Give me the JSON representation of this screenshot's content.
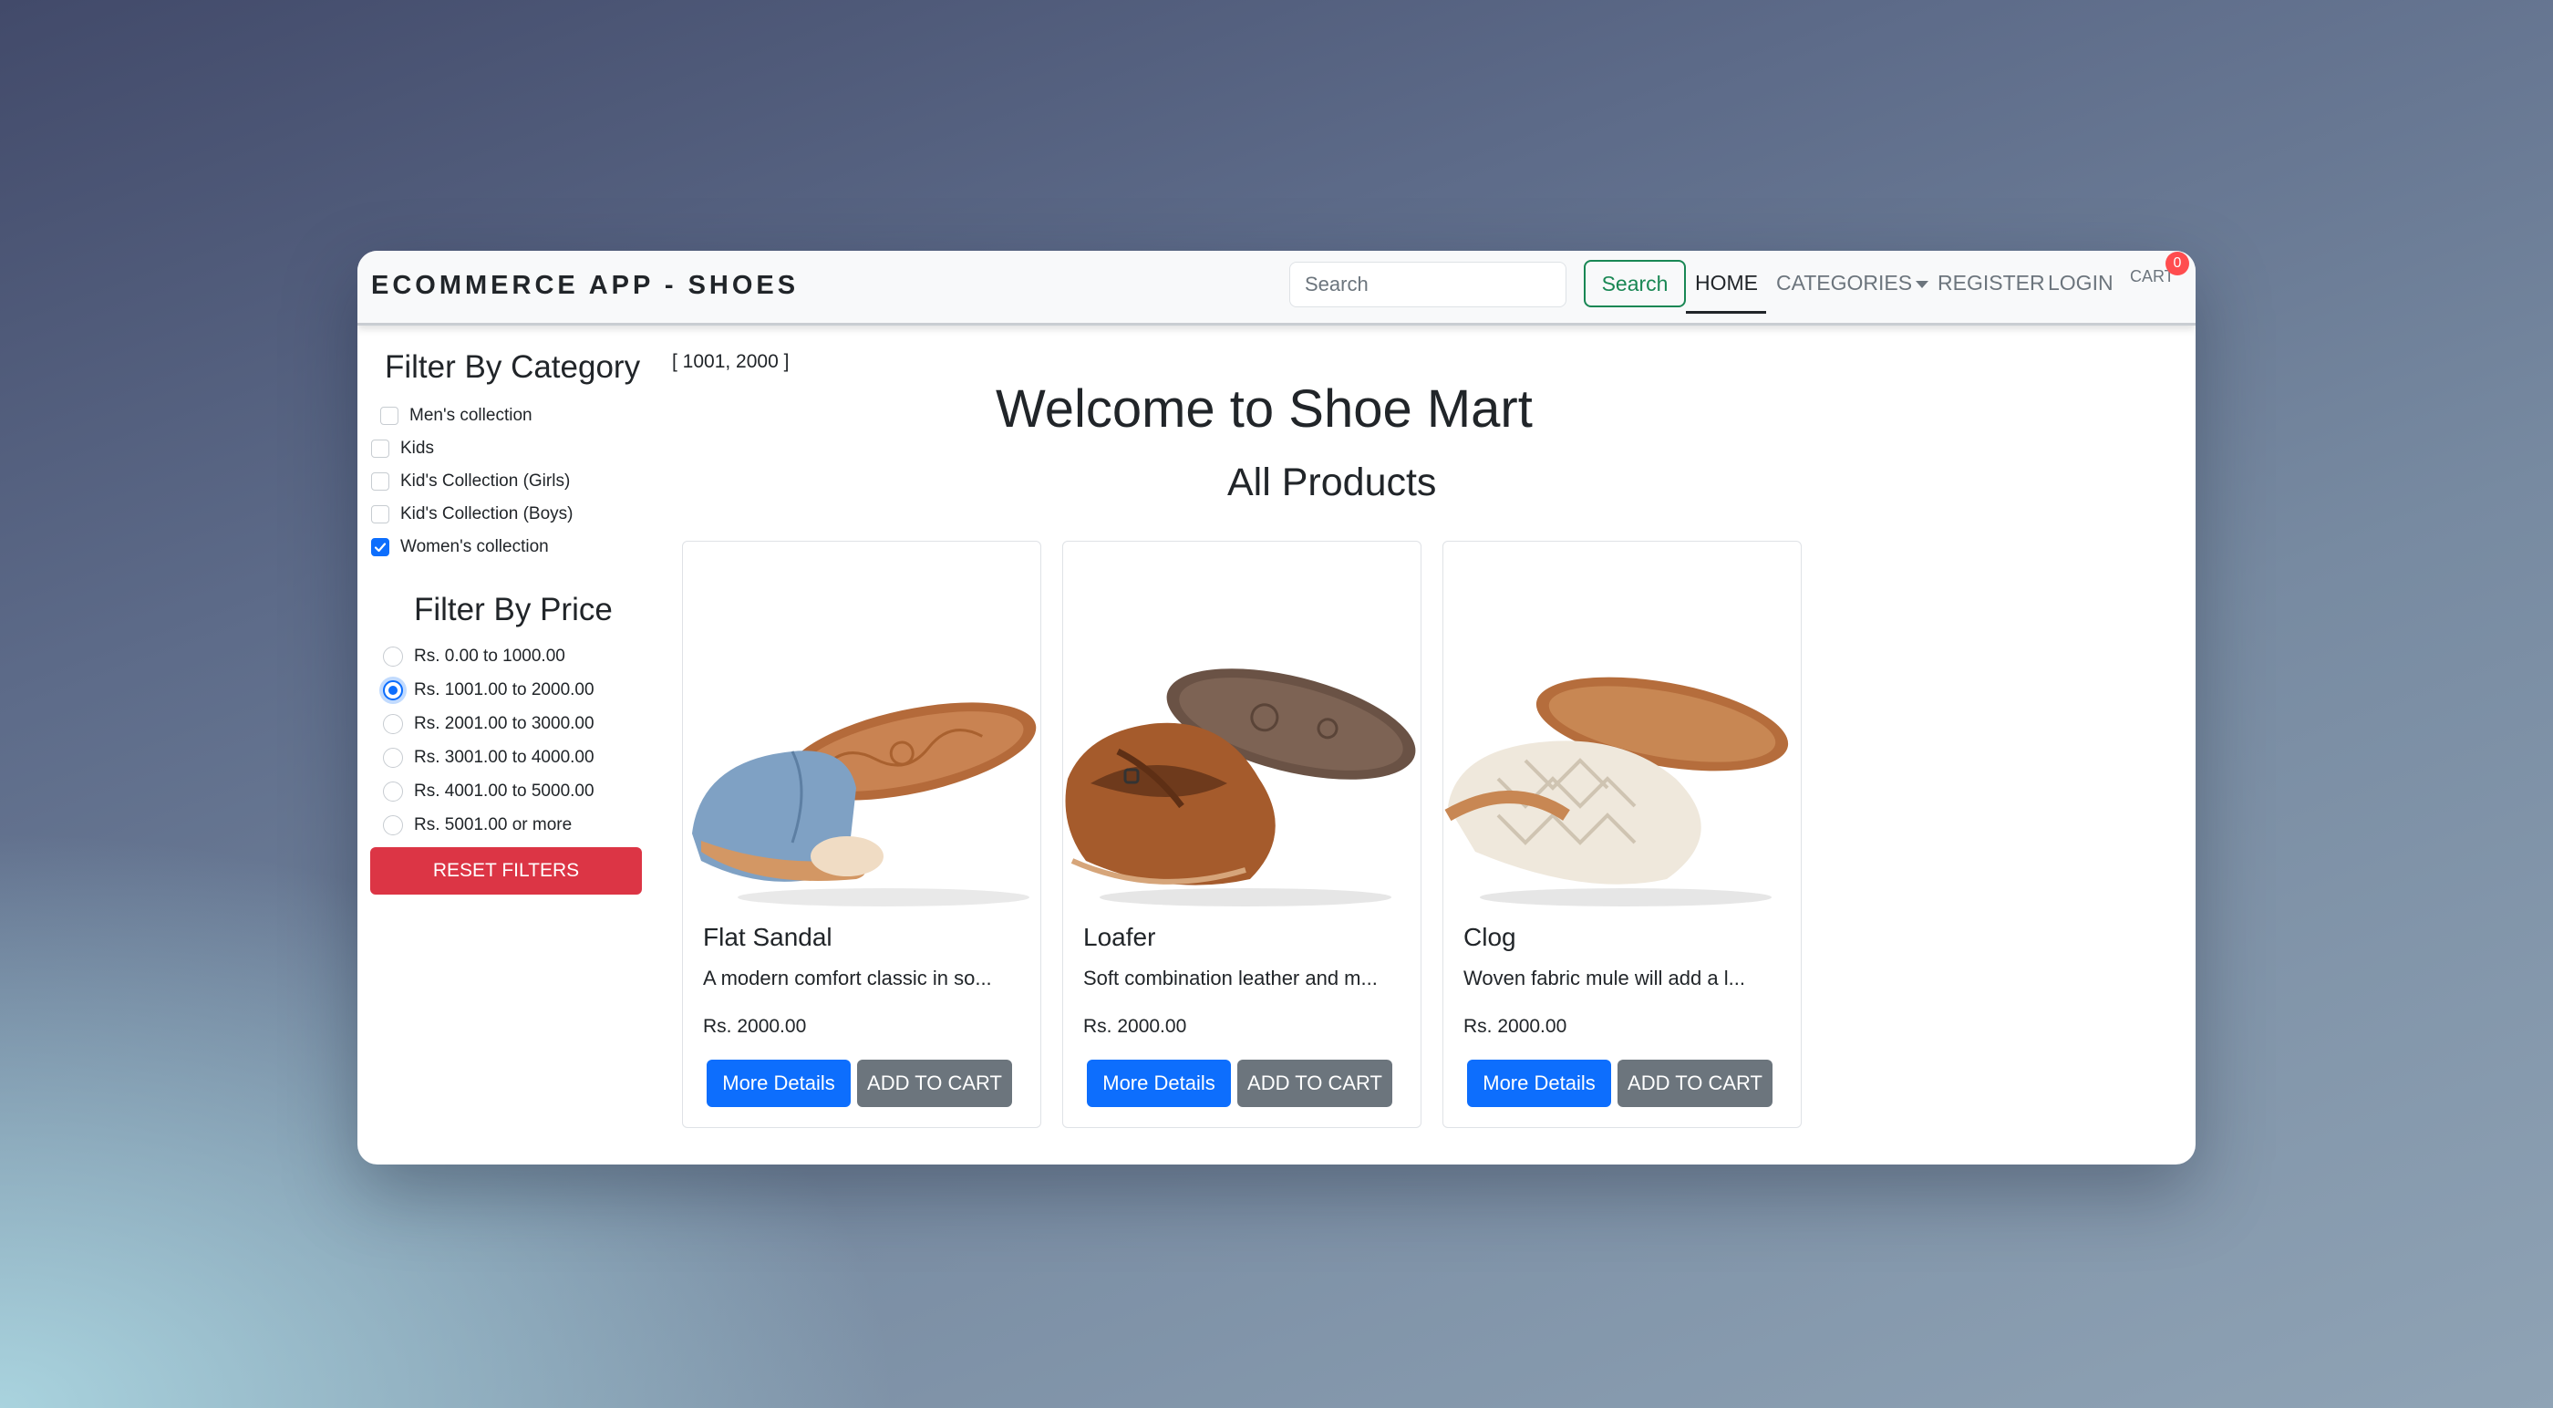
{
  "navbar": {
    "brand": "ECOMMERCE APP - SHOES",
    "search_placeholder": "Search",
    "search_button": "Search",
    "links": {
      "home": "HOME",
      "categories": "CATEGORIES",
      "register": "REGISTER",
      "login": "LOGIN",
      "cart": "CART"
    },
    "cart_count": "0"
  },
  "sidebar": {
    "category_title": "Filter By Category",
    "categories": [
      {
        "label": "Men's collection",
        "checked": false
      },
      {
        "label": "Kids",
        "checked": false
      },
      {
        "label": "Kid's Collection (Girls)",
        "checked": false
      },
      {
        "label": "Kid's Collection (Boys)",
        "checked": false
      },
      {
        "label": "Women's collection",
        "checked": true
      }
    ],
    "price_title": "Filter By Price",
    "prices": [
      {
        "label": "Rs. 0.00 to 1000.00",
        "checked": false
      },
      {
        "label": "Rs. 1001.00 to 2000.00",
        "checked": true
      },
      {
        "label": "Rs. 2001.00 to 3000.00",
        "checked": false
      },
      {
        "label": "Rs. 3001.00 to 4000.00",
        "checked": false
      },
      {
        "label": "Rs. 4001.00 to 5000.00",
        "checked": false
      },
      {
        "label": "Rs. 5001.00 or more",
        "checked": false
      }
    ],
    "reset_button": "RESET FILTERS"
  },
  "main": {
    "range_text": "[ 1001, 2000 ]",
    "welcome_title": "Welcome to Shoe Mart",
    "section_title": "All Products",
    "products": [
      {
        "name": "Flat Sandal",
        "description": "A modern comfort classic in so...",
        "price": "Rs. 2000.00",
        "more_label": "More Details",
        "cart_label": "ADD TO CART"
      },
      {
        "name": "Loafer",
        "description": "Soft combination leather and m...",
        "price": "Rs. 2000.00",
        "more_label": "More Details",
        "cart_label": "ADD TO CART"
      },
      {
        "name": "Clog",
        "description": "Woven fabric mule will add a l...",
        "price": "Rs. 2000.00",
        "more_label": "More Details",
        "cart_label": "ADD TO CART"
      }
    ]
  },
  "colors": {
    "primary": "#0d6efd",
    "secondary": "#6c757d",
    "danger": "#dc3545",
    "success": "#198754",
    "badge": "#ff4d4f"
  }
}
